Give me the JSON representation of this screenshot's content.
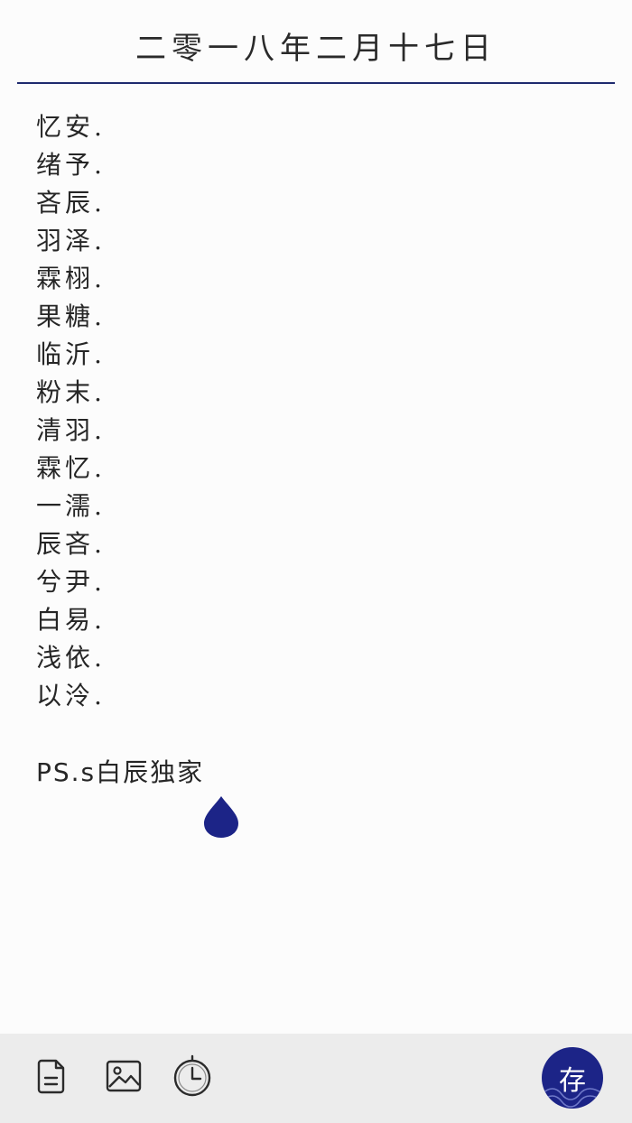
{
  "header": {
    "date": "二零一八年二月十七日"
  },
  "content": {
    "lines": [
      "忆安.",
      "绪予.",
      "吝辰.",
      "羽泽.",
      "霖栩.",
      "果糖.",
      "临沂.",
      "粉末.",
      "清羽.",
      "霖忆.",
      "一濡.",
      "辰吝.",
      "兮尹.",
      "白易.",
      "浅依.",
      "以泠."
    ],
    "ps_note": "PS.s白辰独家"
  },
  "toolbar": {
    "save_label": "存",
    "icons": [
      "document-icon",
      "image-icon",
      "timer-icon"
    ]
  },
  "colors": {
    "accent": "#1c2487",
    "rule": "#1e2a6e",
    "toolbar_bg": "#ececec"
  }
}
